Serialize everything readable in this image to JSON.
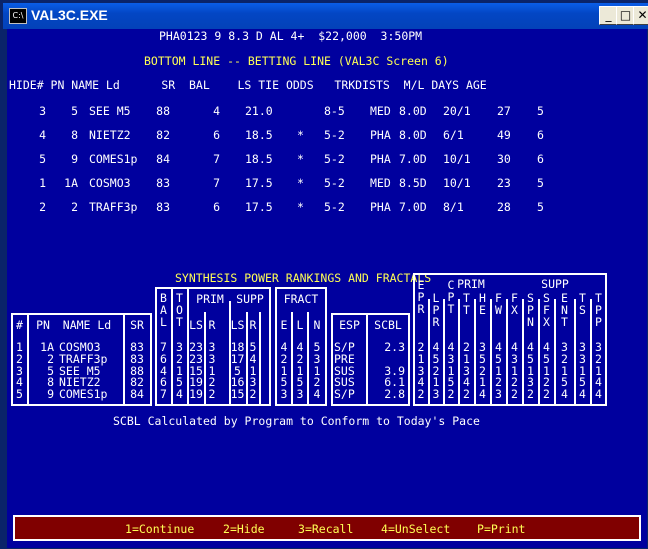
{
  "window": {
    "title": "VAL3C.EXE",
    "icon": "dos-console-icon"
  },
  "header": {
    "info": "PHA0123 9 8.3 D AL 4+  $22,000  3:50PM",
    "subtitle": "BOTTOM LINE -- BETTING LINE (VAL3C Screen 6)"
  },
  "betting": {
    "columns": [
      "HIDE#",
      "PN",
      "NAME Ld",
      "SR",
      "BAL",
      "LS",
      "TIE",
      "ODDS",
      "TRK",
      "DIST",
      "S",
      "M/L",
      "DAYS",
      "AGE"
    ],
    "header_line": "HIDE# PN NAME Ld      SR  BAL    LS TIE ODDS   TRKDISTS  M/L DAYS AGE",
    "rows": [
      {
        "hide": "3",
        "pn": "5",
        "name": "SEE M5",
        "sr": "88",
        "bal": "4",
        "ls": "21.0",
        "tie": "",
        "odds": "8-5",
        "trk": "MED",
        "dist": "8.0D",
        "ml": "20/1",
        "days": "27",
        "age": "5"
      },
      {
        "hide": "4",
        "pn": "8",
        "name": "NIETZ2",
        "sr": "82",
        "bal": "6",
        "ls": "18.5",
        "tie": "*",
        "odds": "5-2",
        "trk": "PHA",
        "dist": "8.0D",
        "ml": "6/1",
        "days": "49",
        "age": "6"
      },
      {
        "hide": "5",
        "pn": "9",
        "name": "COMES1p",
        "sr": "84",
        "bal": "7",
        "ls": "18.5",
        "tie": "*",
        "odds": "5-2",
        "trk": "PHA",
        "dist": "7.0D",
        "ml": "10/1",
        "days": "30",
        "age": "6"
      },
      {
        "hide": "1",
        "pn": "1A",
        "name": "COSMO3",
        "sr": "83",
        "bal": "7",
        "ls": "17.5",
        "tie": "*",
        "odds": "5-2",
        "trk": "MED",
        "dist": "8.5D",
        "ml": "10/1",
        "days": "23",
        "age": "5"
      },
      {
        "hide": "2",
        "pn": "2",
        "name": "TRAFF3p",
        "sr": "83",
        "bal": "6",
        "ls": "17.5",
        "tie": "*",
        "odds": "5-2",
        "trk": "PHA",
        "dist": "7.0D",
        "ml": "8/1",
        "days": "28",
        "age": "5"
      }
    ]
  },
  "synthesis": {
    "title": "SYNTHESIS POWER RANKINGS AND FRACTALS",
    "group_labels": {
      "prim": "PRIM",
      "supp": "SUPP",
      "fract": "FRACT",
      "prim2": "PRIM",
      "supp2": "SUPP"
    },
    "col_headers": {
      "hash": "#",
      "pn": "PN",
      "name": "NAME Ld",
      "sr": "SR",
      "bal": "B\nA\nL",
      "tot": "T\nO\nT",
      "prim_ls": "LS",
      "prim_r": "R",
      "supp_ls": "LS",
      "supp_r": "R",
      "fract_e": "E",
      "fract_l": "L",
      "fract_n": "N",
      "esp": "ESP",
      "scbl": "SCBL",
      "epr": "E\nP\nR",
      "lpr": "L\nP\nR",
      "cpt": "C\nP\nT",
      "tt": "T\nT",
      "he": "H\nE",
      "fw": "F\nW",
      "fx": "F\nX",
      "spn": "S\nP\nN",
      "sfx": "S\nF\nX",
      "ent": "E\nN\nT",
      "ts": "T\nS",
      "tpp": "T\nP\nP"
    },
    "rows": [
      {
        "n": "1",
        "pn": "1A",
        "name": "COSMO3",
        "sr": "83",
        "bal": "7",
        "tot": "3",
        "pls": "23",
        "pr": "3",
        "sls": "18",
        "sr2": "5",
        "e": "4",
        "l": "4",
        "nn": "5",
        "esp": "S/P",
        "scbl": "2.3",
        "c": [
          "2",
          "4",
          "4",
          "2",
          "3",
          "4",
          "4",
          "4",
          "4",
          "3",
          "3",
          "3"
        ]
      },
      {
        "n": "2",
        "pn": "2",
        "name": "TRAFF3p",
        "sr": "83",
        "bal": "6",
        "tot": "2",
        "pls": "23",
        "pr": "3",
        "sls": "17",
        "sr2": "4",
        "e": "2",
        "l": "2",
        "nn": "3",
        "esp": "PRE",
        "scbl": "",
        "c": [
          "1",
          "5",
          "3",
          "1",
          "5",
          "5",
          "3",
          "5",
          "5",
          "2",
          "3",
          "2"
        ]
      },
      {
        "n": "3",
        "pn": "5",
        "name": "SEE M5",
        "sr": "88",
        "bal": "4",
        "tot": "1",
        "pls": "15",
        "pr": "1",
        "sls": "5",
        "sr2": "1",
        "e": "1",
        "l": "1",
        "nn": "1",
        "esp": "SUS",
        "scbl": "3.9",
        "c": [
          "3",
          "2",
          "1",
          "3",
          "2",
          "1",
          "1",
          "1",
          "1",
          "1",
          "1",
          "1"
        ]
      },
      {
        "n": "4",
        "pn": "8",
        "name": "NIETZ2",
        "sr": "82",
        "bal": "6",
        "tot": "5",
        "pls": "19",
        "pr": "2",
        "sls": "16",
        "sr2": "3",
        "e": "5",
        "l": "5",
        "nn": "2",
        "esp": "SUS",
        "scbl": "6.1",
        "c": [
          "4",
          "1",
          "5",
          "4",
          "1",
          "2",
          "2",
          "3",
          "2",
          "5",
          "5",
          "4"
        ]
      },
      {
        "n": "5",
        "pn": "9",
        "name": "COMES1p",
        "sr": "84",
        "bal": "7",
        "tot": "4",
        "pls": "19",
        "pr": "2",
        "sls": "15",
        "sr2": "2",
        "e": "3",
        "l": "3",
        "nn": "4",
        "esp": "S/P",
        "scbl": "2.8",
        "c": [
          "2",
          "3",
          "2",
          "2",
          "4",
          "3",
          "2",
          "2",
          "2",
          "4",
          "4",
          "4"
        ]
      }
    ],
    "note": "SCBL Calculated by Program to Conform to Today's Pace"
  },
  "footer": {
    "items": [
      {
        "key": "1",
        "label": "=Continue"
      },
      {
        "key": "2",
        "label": "=Hide"
      },
      {
        "key": "3",
        "label": "=Recall"
      },
      {
        "key": "4",
        "label": "=UnSelect"
      },
      {
        "key": "P",
        "label": "=Print"
      }
    ]
  },
  "colors": {
    "screen_bg": "#00009e",
    "yellow": "#ffff55",
    "green": "#55ff55",
    "red": "#ff5555",
    "footer_bg": "#800000"
  }
}
